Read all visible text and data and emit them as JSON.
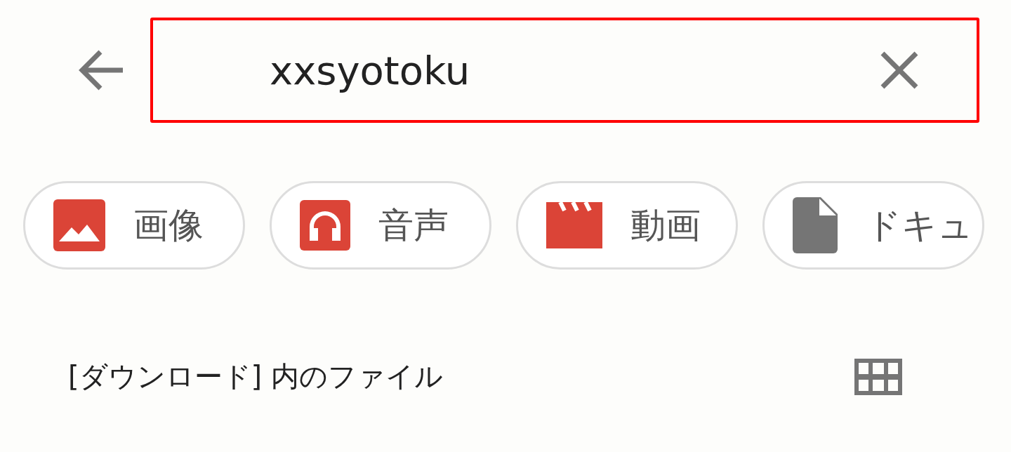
{
  "search": {
    "value": "xxsyotoku"
  },
  "chips": [
    {
      "kind": "image",
      "label": "画像"
    },
    {
      "kind": "audio",
      "label": "音声"
    },
    {
      "kind": "video",
      "label": "動画"
    },
    {
      "kind": "document",
      "label": "ドキュ"
    }
  ],
  "section": {
    "title": "[ダウンロード] 内のファイル"
  }
}
